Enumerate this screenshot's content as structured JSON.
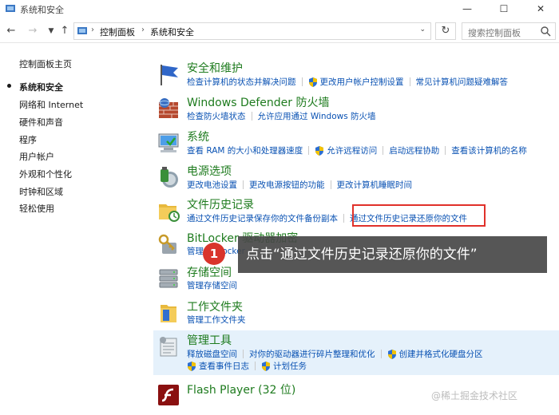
{
  "window": {
    "title": "系统和安全"
  },
  "nav": {
    "breadcrumbs": [
      "控制面板",
      "系统和安全"
    ],
    "search_placeholder": "搜索控制面板"
  },
  "sidebar": {
    "items": [
      {
        "label": "控制面板主页",
        "current": false
      },
      {
        "label": "系统和安全",
        "current": true
      },
      {
        "label": "网络和 Internet",
        "current": false
      },
      {
        "label": "硬件和声音",
        "current": false
      },
      {
        "label": "程序",
        "current": false
      },
      {
        "label": "用户帐户",
        "current": false
      },
      {
        "label": "外观和个性化",
        "current": false
      },
      {
        "label": "时钟和区域",
        "current": false
      },
      {
        "label": "轻松使用",
        "current": false
      }
    ]
  },
  "categories": [
    {
      "title": "安全和维护",
      "links": [
        [
          "检查计算机的状态并解决问题",
          "更改用户帐户控制设置",
          "常见计算机问题疑难解答"
        ]
      ]
    },
    {
      "title": "Windows Defender 防火墙",
      "links": [
        [
          "检查防火墙状态",
          "允许应用通过 Windows 防火墙"
        ]
      ]
    },
    {
      "title": "系统",
      "links": [
        [
          "查看 RAM 的大小和处理器速度",
          "允许远程访问",
          "启动远程协助",
          "查看该计算机的名称"
        ]
      ]
    },
    {
      "title": "电源选项",
      "links": [
        [
          "更改电池设置",
          "更改电源按钮的功能",
          "更改计算机睡眠时间"
        ]
      ]
    },
    {
      "title": "文件历史记录",
      "links": [
        [
          "通过文件历史记录保存你的文件备份副本",
          "通过文件历史记录还原你的文件"
        ]
      ]
    },
    {
      "title": "BitLocker 驱动器加密",
      "links": [
        [
          "管理 BitLocker"
        ]
      ]
    },
    {
      "title": "存储空间",
      "links": [
        [
          "管理存储空间"
        ]
      ]
    },
    {
      "title": "工作文件夹",
      "links": [
        [
          "管理工作文件夹"
        ]
      ]
    },
    {
      "title": "管理工具",
      "links": [
        [
          "释放磁盘空间",
          "对你的驱动器进行碎片整理和优化",
          "创建并格式化硬盘分区"
        ],
        [
          "查看事件日志",
          "计划任务"
        ]
      ]
    },
    {
      "title": "Flash Player (32 位)",
      "links": []
    }
  ],
  "callout": {
    "number": "1",
    "text": "点击“通过文件历史记录还原你的文件”"
  },
  "watermark": "@稀土掘金技术社区",
  "colors": {
    "link": "#0a52b3",
    "category_title": "#1e7b1e",
    "highlight_box": "#e0312a"
  }
}
